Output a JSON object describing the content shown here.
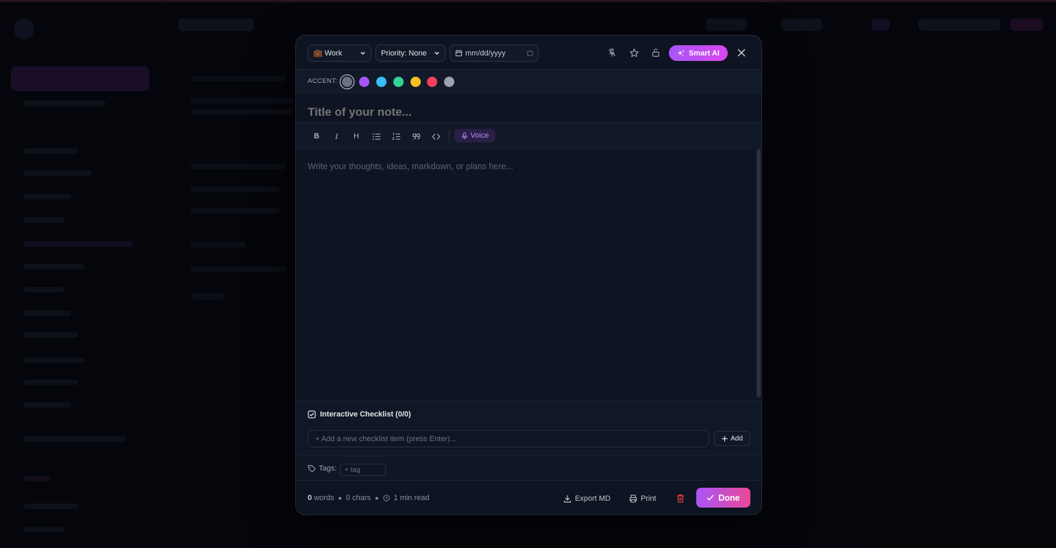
{
  "editor": {
    "category": "💼 Work",
    "priority": "Priority: None",
    "date_placeholder": "mm/dd/yyyy",
    "smart_ai_label": "Smart AI",
    "accent_label": "ACCENT:",
    "accent_colors": [
      "#6b7280",
      "#a855f7",
      "#38bdf8",
      "#34d399",
      "#fbbf24",
      "#f43f5e",
      "#9ca3af"
    ],
    "title_placeholder": "Title of your note...",
    "format_tools": [
      "B",
      "I",
      "H"
    ],
    "voice_label": "Voice",
    "body_placeholder": "Write your thoughts, ideas, markdown, or plans here...",
    "checklist": {
      "heading": "Interactive Checklist (0/0)",
      "input_placeholder": "+ Add a new checklist item (press Enter)...",
      "add_label": "Add"
    },
    "tags": {
      "label": "Tags:",
      "placeholder": "+ tag"
    },
    "footer": {
      "words_count": "0",
      "words_unit": "words",
      "chars_count": "0",
      "chars_unit": "chars",
      "read_time": "1 min read",
      "export_label": "Export MD",
      "print_label": "Print",
      "done_label": "Done"
    }
  },
  "colors": {
    "accent_gradient_start": "#a855f7",
    "accent_gradient_end": "#ec4899",
    "danger": "#ef4444",
    "modal_bg": "#0e1422"
  }
}
